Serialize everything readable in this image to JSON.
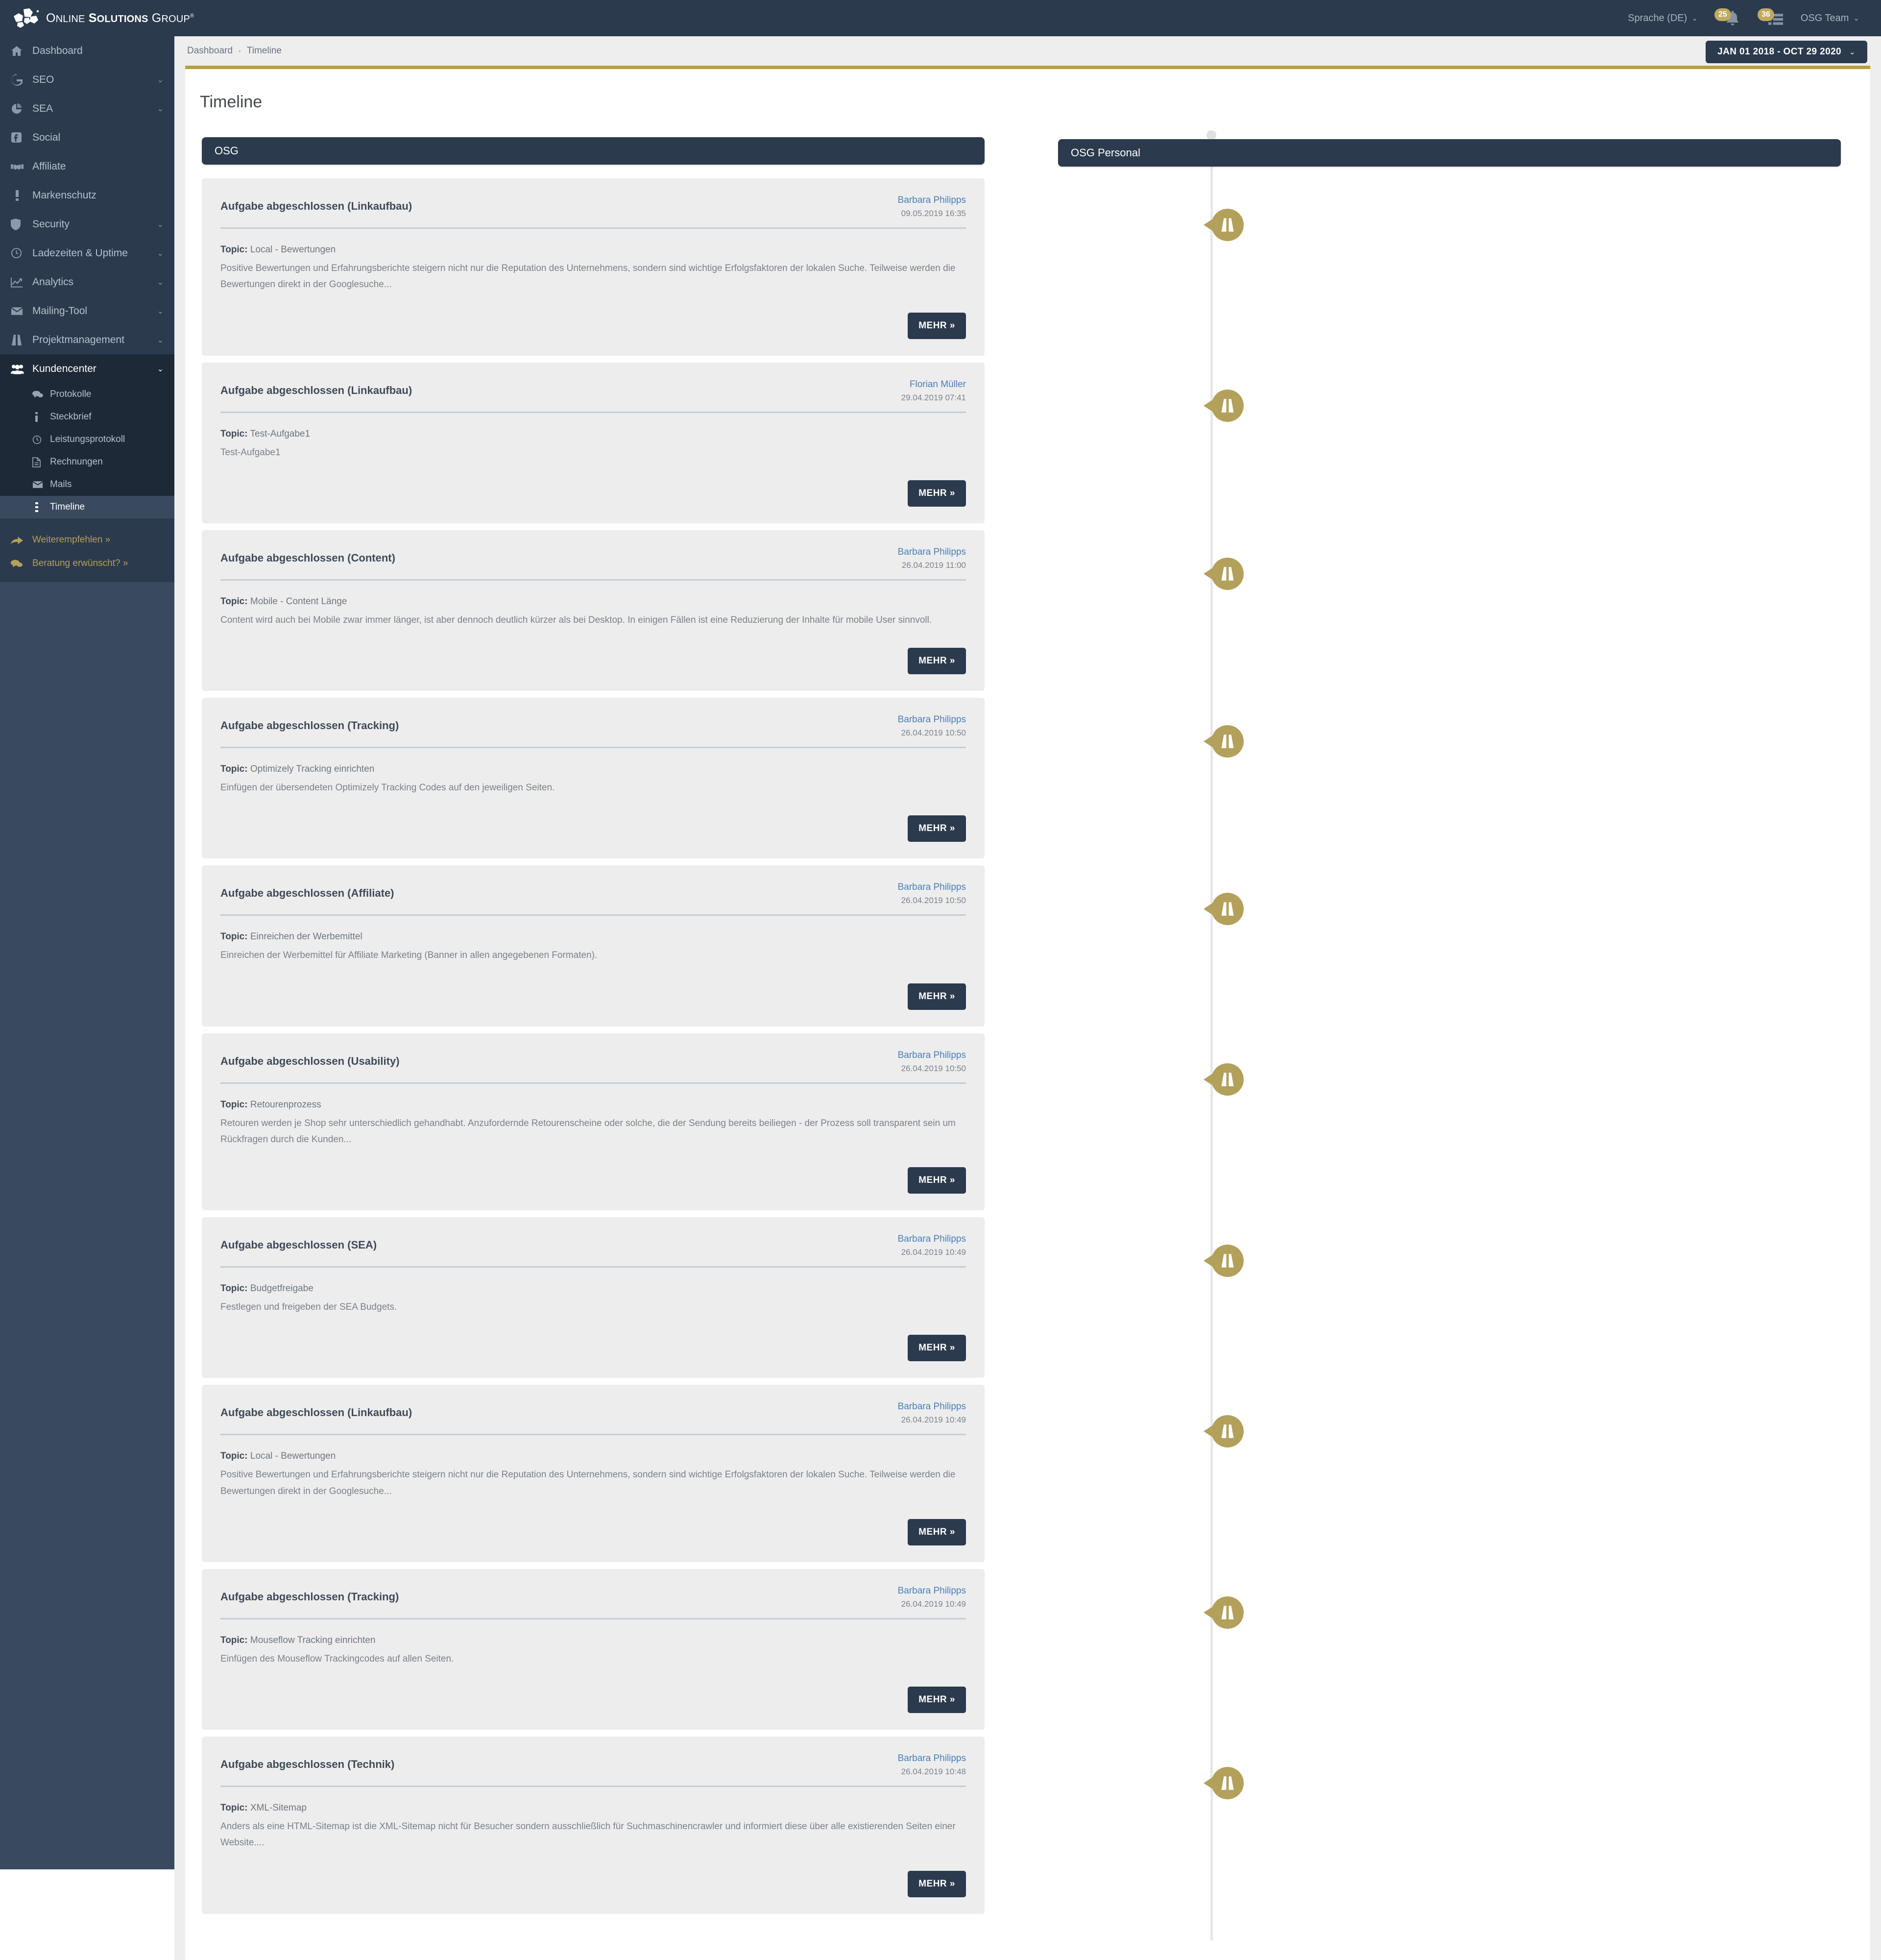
{
  "brand": {
    "line_1": "Online",
    "line_2": "Solutions",
    "line_3": "Group",
    "registered": "®",
    "logo_icon": "osg-logo-icon"
  },
  "topbar": {
    "language": "Sprache (DE)",
    "language_caret": "⌄",
    "notifications_count": "25",
    "notifications_icon": "bell-icon",
    "tasks_count": "36",
    "tasks_icon": "list-icon",
    "account": "OSG Team",
    "account_caret": "⌄"
  },
  "sidebar": {
    "items": [
      {
        "label": "Dashboard",
        "icon": "home-icon",
        "caret": ""
      },
      {
        "label": "SEO",
        "icon": "google-icon",
        "caret": "⌄"
      },
      {
        "label": "SEA",
        "icon": "pie-chart-icon",
        "caret": "⌄"
      },
      {
        "label": "Social",
        "icon": "facebook-icon",
        "caret": ""
      },
      {
        "label": "Affiliate",
        "icon": "handshake-icon",
        "caret": ""
      },
      {
        "label": "Markenschutz",
        "icon": "exclamation-icon",
        "caret": ""
      },
      {
        "label": "Security",
        "icon": "shield-icon",
        "caret": "⌄"
      },
      {
        "label": "Ladezeiten & Uptime",
        "icon": "clock-icon",
        "caret": "⌄"
      },
      {
        "label": "Analytics",
        "icon": "chart-line-icon",
        "caret": "⌄"
      },
      {
        "label": "Mailing-Tool",
        "icon": "envelope-icon",
        "caret": "⌄"
      },
      {
        "label": "Projektmanagement",
        "icon": "road-icon",
        "caret": "⌄"
      },
      {
        "label": "Kundencenter",
        "icon": "users-icon",
        "caret": "⌄"
      }
    ],
    "subitems": [
      {
        "label": "Protokolle",
        "icon": "comments-icon"
      },
      {
        "label": "Steckbrief",
        "icon": "info-icon"
      },
      {
        "label": "Leistungsprotokoll",
        "icon": "clock-icon"
      },
      {
        "label": "Rechnungen",
        "icon": "file-icon"
      },
      {
        "label": "Mails",
        "icon": "envelope-icon"
      },
      {
        "label": "Timeline",
        "icon": "timeline-icon"
      }
    ],
    "active_subitem": "Timeline",
    "promos": [
      {
        "label": "Weiterempfehlen »",
        "icon": "share-icon"
      },
      {
        "label": "Beratung erwünscht? »",
        "icon": "comments-icon"
      }
    ]
  },
  "breadcrumb": {
    "root": "Dashboard",
    "separator": "•",
    "current": "Timeline"
  },
  "daterange": {
    "label": "JAN 01 2018 - OCT 29 2020",
    "caret": "⌄"
  },
  "page": {
    "title": "Timeline",
    "column_left": "OSG",
    "column_right": "OSG Personal"
  },
  "more_label": "MEHR »",
  "topic_label": "Topic:",
  "events": [
    {
      "title": "Aufgabe abgeschlossen (Linkaufbau)",
      "author": "Barbara Philipps",
      "date": "09.05.2019 16:35",
      "topic": "Local - Bewertungen",
      "body": "Positive Bewertungen und Erfahrungsberichte steigern nicht nur die Reputation des Unternehmens, sondern sind wichtige Erfolgsfaktoren der lokalen Suche. Teilweise werden die Bewertungen direkt in der Googlesuche...",
      "marker_icon": "road-icon"
    },
    {
      "title": "Aufgabe abgeschlossen (Linkaufbau)",
      "author": "Florian Müller",
      "date": "29.04.2019 07:41",
      "topic": "Test-Aufgabe1",
      "body": "Test-Aufgabe1",
      "marker_icon": "road-icon"
    },
    {
      "title": "Aufgabe abgeschlossen (Content)",
      "author": "Barbara Philipps",
      "date": "26.04.2019 11:00",
      "topic": "Mobile - Content Länge",
      "body": "Content wird auch bei Mobile zwar immer länger, ist aber dennoch deutlich kürzer als bei Desktop. In einigen Fällen ist eine Reduzierung der Inhalte für mobile User sinnvoll.",
      "marker_icon": "road-icon"
    },
    {
      "title": "Aufgabe abgeschlossen (Tracking)",
      "author": "Barbara Philipps",
      "date": "26.04.2019 10:50",
      "topic": "Optimizely Tracking einrichten",
      "body": "Einfügen der übersendeten Optimizely Tracking Codes auf den jeweiligen Seiten.",
      "marker_icon": "road-icon"
    },
    {
      "title": "Aufgabe abgeschlossen (Affiliate)",
      "author": "Barbara Philipps",
      "date": "26.04.2019 10:50",
      "topic": "Einreichen der Werbemittel",
      "body": "Einreichen der Werbemittel für Affiliate Marketing (Banner in allen angegebenen Formaten).",
      "marker_icon": "road-icon"
    },
    {
      "title": "Aufgabe abgeschlossen (Usability)",
      "author": "Barbara Philipps",
      "date": "26.04.2019 10:50",
      "topic": "Retourenprozess",
      "body": "Retouren werden je Shop sehr unterschiedlich gehandhabt. Anzufordernde Retourenscheine oder solche, die der Sendung bereits beiliegen - der Prozess soll transparent sein um Rückfragen durch die Kunden...",
      "marker_icon": "road-icon"
    },
    {
      "title": "Aufgabe abgeschlossen (SEA)",
      "author": "Barbara Philipps",
      "date": "26.04.2019 10:49",
      "topic": "Budgetfreigabe",
      "body": "Festlegen und freigeben der SEA Budgets.",
      "marker_icon": "road-icon"
    },
    {
      "title": "Aufgabe abgeschlossen (Linkaufbau)",
      "author": "Barbara Philipps",
      "date": "26.04.2019 10:49",
      "topic": "Local - Bewertungen",
      "body": "Positive Bewertungen und Erfahrungsberichte steigern nicht nur die Reputation des Unternehmens, sondern sind wichtige Erfolgsfaktoren der lokalen Suche. Teilweise werden die Bewertungen direkt in der Googlesuche...",
      "marker_icon": "road-icon"
    },
    {
      "title": "Aufgabe abgeschlossen (Tracking)",
      "author": "Barbara Philipps",
      "date": "26.04.2019 10:49",
      "topic": "Mouseflow Tracking einrichten",
      "body": "Einfügen des Mouseflow Trackingcodes auf allen Seiten.",
      "marker_icon": "road-icon"
    },
    {
      "title": "Aufgabe abgeschlossen (Technik)",
      "author": "Barbara Philipps",
      "date": "26.04.2019 10:48",
      "topic": "XML-Sitemap",
      "body": "Anders als eine HTML-Sitemap ist die XML-Sitemap nicht für Besucher sondern ausschließlich für Suchmaschinencrawler und informiert diese über alle existierenden Seiten einer Website....",
      "marker_icon": "road-icon"
    }
  ],
  "colors": {
    "sidebar_bg": "#394a5e",
    "sidebar_dark": "#2b3a4d",
    "sidebar_darker": "#1d2936",
    "accent_gold": "#b3a05a",
    "badge_gold": "#c0aa5e",
    "card_bg": "#ededed",
    "link_blue": "#4a7fb5",
    "content_bg": "#eeeeee"
  }
}
